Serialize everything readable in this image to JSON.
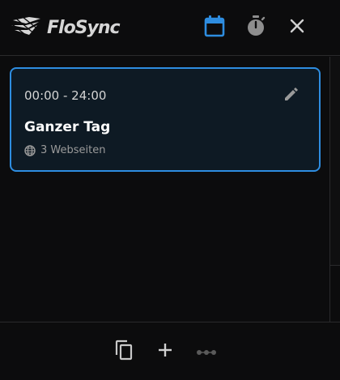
{
  "header": {
    "app_name": "FloSync",
    "accent_color": "#2e8de0",
    "icons": [
      "logo-icon",
      "calendar-icon",
      "timer-icon",
      "close-icon"
    ]
  },
  "schedule": {
    "items": [
      {
        "time_range": "00:00 - 24:00",
        "title": "Ganzer Tag",
        "sites_label": "3 Webseiten"
      }
    ]
  },
  "footer": {
    "icons": [
      "copy-icon",
      "add-icon",
      "more-dots-icon"
    ]
  }
}
